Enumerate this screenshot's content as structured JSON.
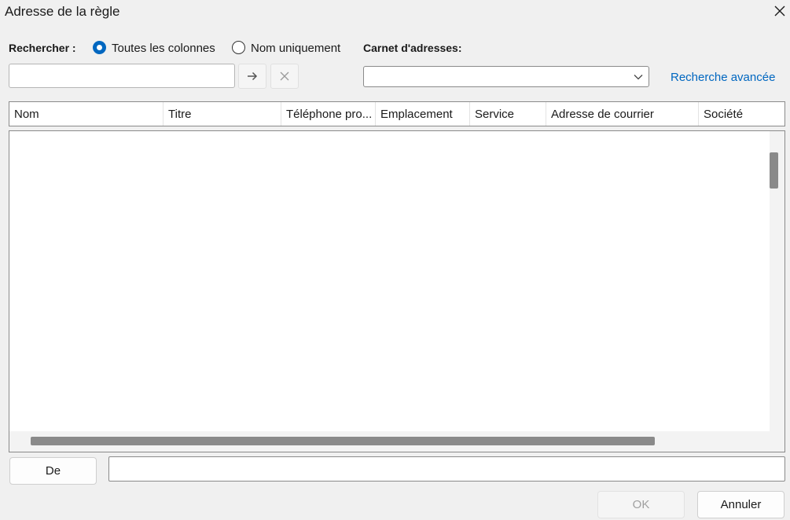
{
  "window": {
    "title": "Adresse de la règle"
  },
  "search": {
    "label": "Rechercher :",
    "options": [
      {
        "label": "Toutes les colonnes",
        "selected": true
      },
      {
        "label": "Nom uniquement",
        "selected": false
      }
    ],
    "query_value": "",
    "address_book_label": "Carnet d'adresses:",
    "address_book_value": "",
    "advanced_link": "Recherche avancée"
  },
  "table": {
    "columns": [
      "Nom",
      "Titre",
      "Téléphone pro...",
      "Emplacement",
      "Service",
      "Adresse de courrier",
      "Société"
    ],
    "rows": []
  },
  "footer": {
    "from_button": "De",
    "from_value": "",
    "ok_button": "OK",
    "cancel_button": "Annuler"
  },
  "colors": {
    "accent": "#0067c0",
    "window_bg": "#f0f0f0",
    "scroll_thumb": "#8a8a8a"
  },
  "icons": {
    "close": "close-icon",
    "go": "arrow-right-icon",
    "clear": "clear-icon",
    "dropdown": "chevron-down-icon"
  }
}
